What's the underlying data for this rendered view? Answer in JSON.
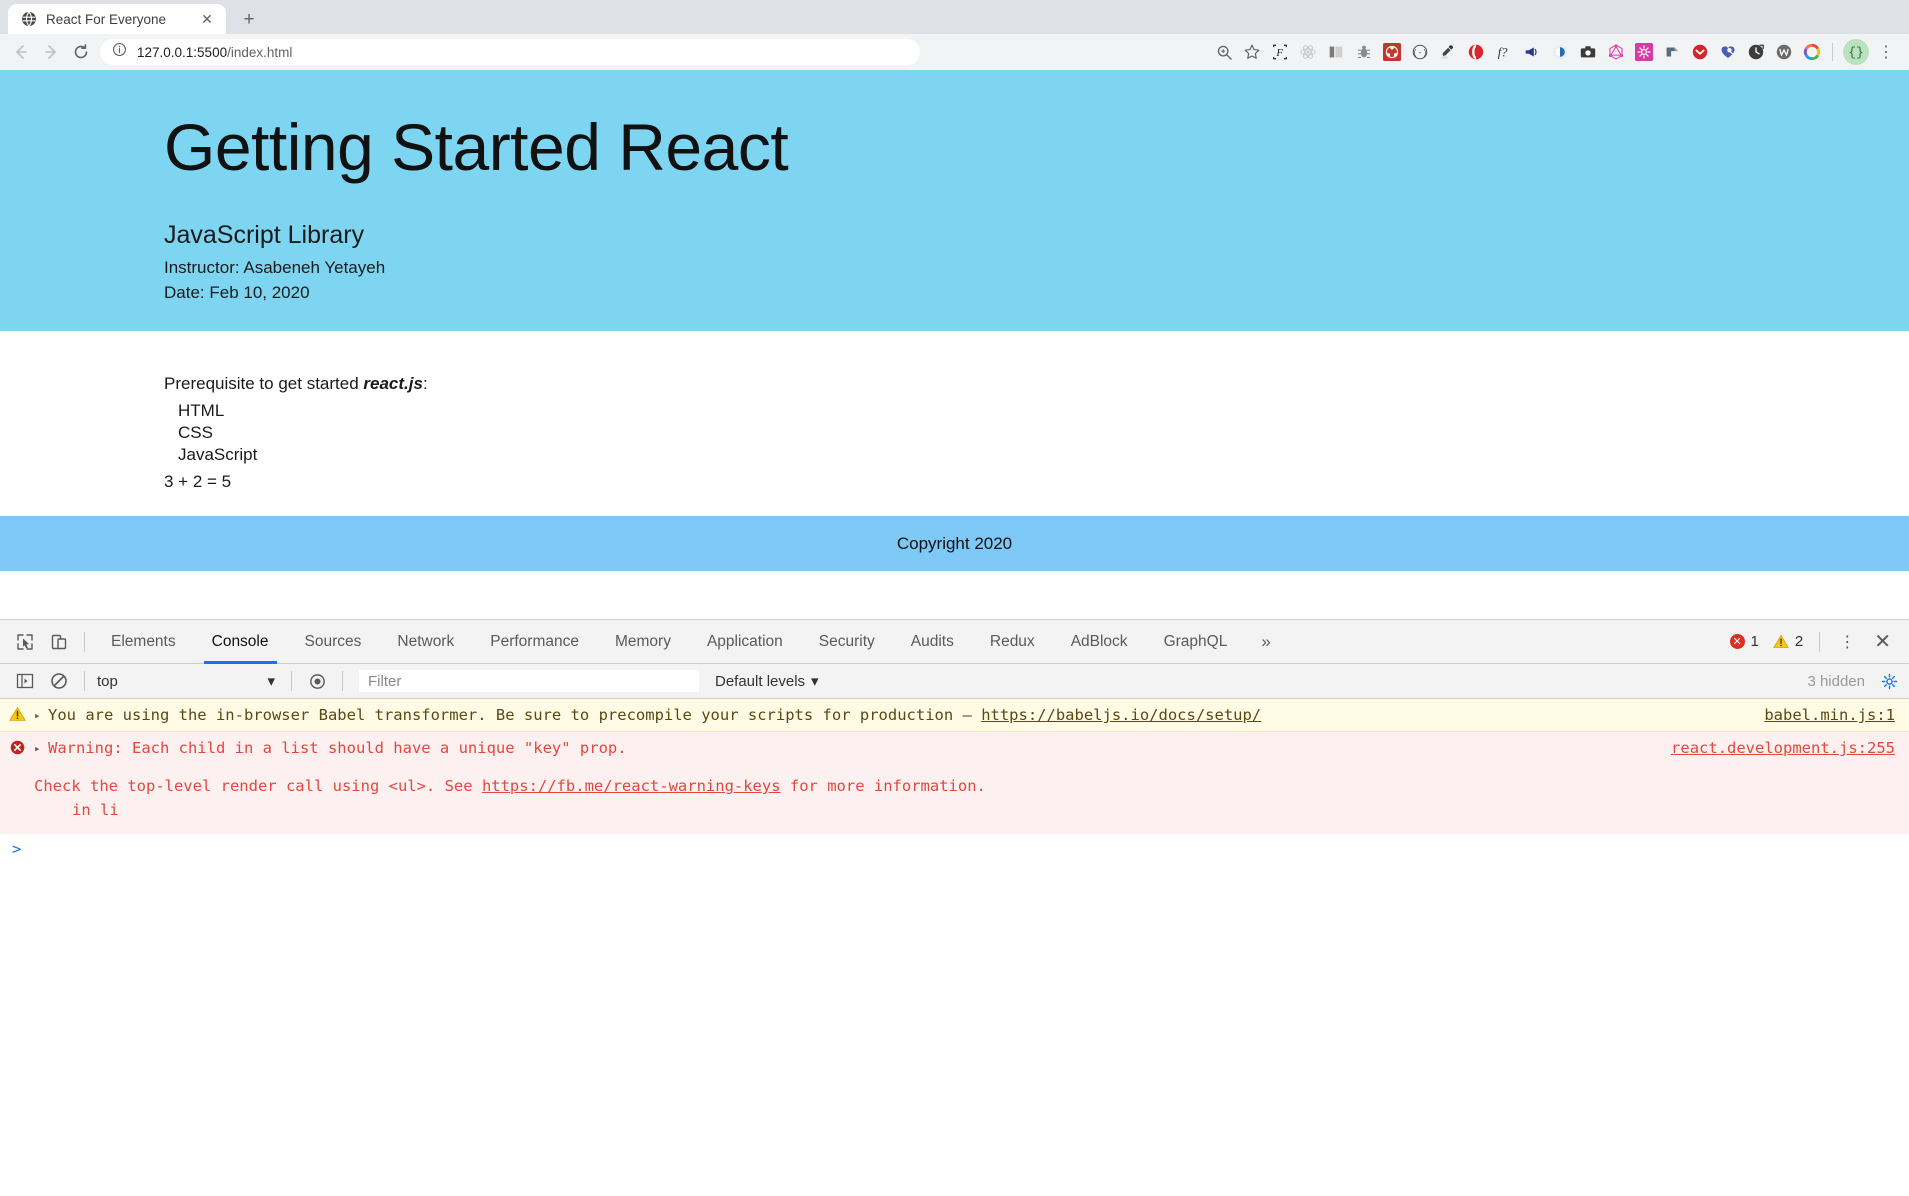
{
  "browser": {
    "tab": {
      "title": "React For Everyone",
      "favicon": "globe-icon",
      "close_label": "✕"
    },
    "new_tab_label": "+",
    "nav": {
      "back": "←",
      "forward": "→",
      "reload": "↻"
    },
    "omnibox": {
      "info_icon": "info-icon",
      "url_main": "127.0.0.1:5500",
      "url_path": "/index.html"
    },
    "extensions": [
      "zoom-icon",
      "bookmark-star-icon",
      "font-icon",
      "react-devtools-icon",
      "split-panel-icon",
      "bug-icon",
      "redux-icon",
      "parens-icon",
      "eyedropper-icon",
      "opera-icon",
      "font-finder-icon",
      "megaphone-icon",
      "clarity-icon",
      "camera-icon",
      "graphql-icon",
      "settings-pink-icon",
      "paper-plane-icon",
      "pocket-icon",
      "wappalyzer-heart-icon",
      "clock-icon",
      "w-icon",
      "color-wheel-icon"
    ],
    "profile": {
      "label": "{}"
    },
    "menu_label": "⋮"
  },
  "page": {
    "title": "Getting Started React",
    "subtitle": "JavaScript Library",
    "instructor": "Instructor: Asabeneh Yetayeh",
    "date": "Date: Feb 10, 2020",
    "prereq_prefix": "Prerequisite to get started ",
    "prereq_emphasis": "react.js",
    "prereq_suffix": ":",
    "prereq_items": [
      "HTML",
      "CSS",
      "JavaScript"
    ],
    "sum_line": "3 + 2 = 5",
    "footer": "Copyright 2020",
    "colors": {
      "header_bg": "#7ed5f2",
      "footer_bg": "#7ec8f5"
    }
  },
  "devtools": {
    "inspect_icon": "inspect-element-icon",
    "device_icon": "device-toolbar-icon",
    "tabs": [
      {
        "label": "Elements",
        "active": false
      },
      {
        "label": "Console",
        "active": true
      },
      {
        "label": "Sources",
        "active": false
      },
      {
        "label": "Network",
        "active": false
      },
      {
        "label": "Performance",
        "active": false
      },
      {
        "label": "Memory",
        "active": false
      },
      {
        "label": "Application",
        "active": false
      },
      {
        "label": "Security",
        "active": false
      },
      {
        "label": "Audits",
        "active": false
      },
      {
        "label": "Redux",
        "active": false
      },
      {
        "label": "AdBlock",
        "active": false
      },
      {
        "label": "GraphQL",
        "active": false
      }
    ],
    "more_tabs_label": "»",
    "error_count": "1",
    "warning_count": "2",
    "menu_label": "⋮",
    "close_label": "✕",
    "toolbar": {
      "execute_icon": "console-sidebar-icon",
      "clear_icon": "clear-console-icon",
      "context": "top",
      "context_caret": "▾",
      "eye_icon": "live-expression-icon",
      "filter_placeholder": "Filter",
      "levels_label": "Default levels",
      "levels_caret": "▾",
      "hidden_label": "3 hidden",
      "settings_icon": "gear-icon"
    },
    "messages": [
      {
        "type": "warning",
        "icon": "warning-triangle-icon",
        "arrow": "▸",
        "text_before_link": "You are using the in-browser Babel transformer. Be sure to precompile your scripts for production – ",
        "link": "https://babeljs.io/docs/setup/",
        "source": "babel.min.js:1"
      },
      {
        "type": "error",
        "icon": "error-circle-icon",
        "arrow": "▸",
        "text": "Warning: Each child in a list should have a unique \"key\" prop.",
        "source": "react.development.js:255",
        "detail_before_link": "Check the top-level render call using <ul>. See ",
        "detail_link": "https://fb.me/react-warning-keys",
        "detail_after_link": " for more information.",
        "detail_stack": "in li"
      }
    ],
    "prompt": ">"
  }
}
